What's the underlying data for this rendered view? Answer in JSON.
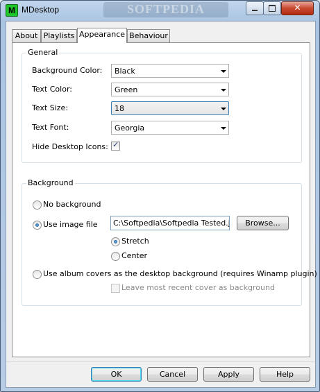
{
  "window": {
    "title": "MDesktop",
    "icon_letter": "M",
    "watermark": "SOFTPEDIA",
    "close_glyph": "✕"
  },
  "tabs": [
    {
      "label": "About"
    },
    {
      "label": "Playlists"
    },
    {
      "label": "Appearance"
    },
    {
      "label": "Behaviour"
    }
  ],
  "active_tab": "Appearance",
  "general": {
    "title": "General",
    "background_color": {
      "label": "Background Color:",
      "value": "Black"
    },
    "text_color": {
      "label": "Text Color:",
      "value": "Green"
    },
    "text_size": {
      "label": "Text Size:",
      "value": "18"
    },
    "text_font": {
      "label": "Text Font:",
      "value": "Georgia"
    },
    "hide_icons": {
      "label": "Hide Desktop Icons:",
      "checked": true
    }
  },
  "background": {
    "title": "Background",
    "no_background": {
      "label": "No background",
      "selected": false
    },
    "use_image": {
      "label": "Use image file",
      "selected": true
    },
    "image_path": "C:\\Softpedia\\Softpedia Tested.jpg",
    "browse_label": "Browse...",
    "stretch": {
      "label": "Stretch",
      "selected": true
    },
    "center": {
      "label": "Center",
      "selected": false
    },
    "album_covers": {
      "label": "Use album covers as the desktop background (requires Winamp plugin)",
      "selected": false
    },
    "leave_recent": {
      "label": "Leave most recent cover as background",
      "checked": false,
      "enabled": false
    }
  },
  "buttons": {
    "ok": "OK",
    "cancel": "Cancel",
    "apply": "Apply",
    "help": "Help"
  }
}
